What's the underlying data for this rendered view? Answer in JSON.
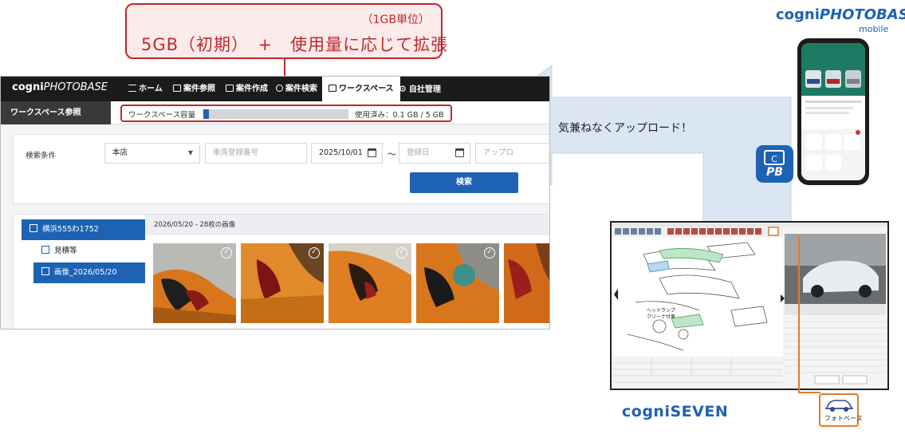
{
  "callout": {
    "unit_note": "（1GB単位）",
    "main_text": "5GB（初期）　+　使用量に応じて拡張"
  },
  "web": {
    "logo_prefix": "cogni",
    "logo_suffix": "PHOTOBASE",
    "nav": [
      {
        "label": "ホーム",
        "icon": "list-icon"
      },
      {
        "label": "案件参照",
        "icon": "image-icon"
      },
      {
        "label": "案件作成",
        "icon": "add-image-icon"
      },
      {
        "label": "案件検索",
        "icon": "search-icon"
      },
      {
        "label": "ワークスペース",
        "icon": "workspace-icon",
        "active": true
      },
      {
        "label": "自社管理",
        "icon": "gear-icon"
      }
    ],
    "page_title": "ワークスペース参照",
    "capacity": {
      "label": "ワークスペース容量",
      "used_text": "使用済み：0.1 GB / 5 GB",
      "used_fraction": 0.02
    },
    "search": {
      "label": "検索条件",
      "store_value": "本店",
      "plate_placeholder": "車両登録番号",
      "date_from": "2025/10/01",
      "range_sep": "〜",
      "date_to_placeholder": "登録日",
      "upload_placeholder": "アップロ",
      "button": "検索"
    },
    "tree": [
      {
        "label": "横浜555わ1752",
        "selected": true,
        "level": 0
      },
      {
        "label": "見積等",
        "selected": false,
        "level": 1
      },
      {
        "label": "画像_2026/05/20",
        "selected": true,
        "level": 1
      }
    ],
    "images_header": "2026/05/20 - 28枚の画像"
  },
  "arrow_text": "気兼ねなくアップロード！",
  "brand": {
    "photobase_prefix": "cogni",
    "photobase_suffix": "PHOTOBASE",
    "mobile": "mobile",
    "seven_prefix": "cogni",
    "seven_suffix": "SEVEN",
    "app_icon_text": "PB",
    "photo_icon_label": "フォトベース"
  },
  "seven_ui": {
    "label_headlamp": "ヘッドランプ",
    "label_cleaner": "クリーナ付車"
  },
  "colors": {
    "accent_blue": "#1e62b4",
    "callout_red": "#c0282d",
    "arrow_fill": "#dbe6f3",
    "highlight_orange": "#e07b2e"
  }
}
